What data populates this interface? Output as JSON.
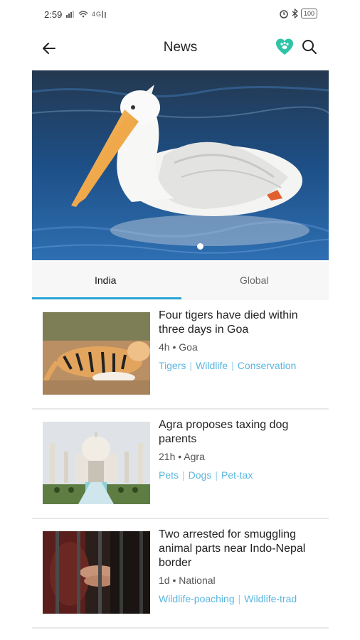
{
  "status_bar": {
    "time": "2:59",
    "battery": "100"
  },
  "header": {
    "title": "News"
  },
  "tabs": [
    {
      "label": "India",
      "selected": true
    },
    {
      "label": "Global",
      "selected": false
    }
  ],
  "articles": [
    {
      "headline": "Four tigers have died within three days in Goa",
      "age": "4h",
      "location": "Goa",
      "tags": [
        "Tigers",
        "Wildlife",
        "Conservation"
      ]
    },
    {
      "headline": "Agra proposes taxing dog parents",
      "age": "21h",
      "location": "Agra",
      "tags": [
        "Pets",
        "Dogs",
        "Pet-tax"
      ]
    },
    {
      "headline": "Two arrested for smuggling animal parts near Indo-Nepal border",
      "age": "1d",
      "location": "National",
      "tags": [
        "Wildlife-poaching",
        "Wildlife-trad"
      ]
    }
  ],
  "colors": {
    "accent": "#2aa5d8",
    "tag": "#5ab6e0",
    "heart": "#2ec4a6"
  }
}
